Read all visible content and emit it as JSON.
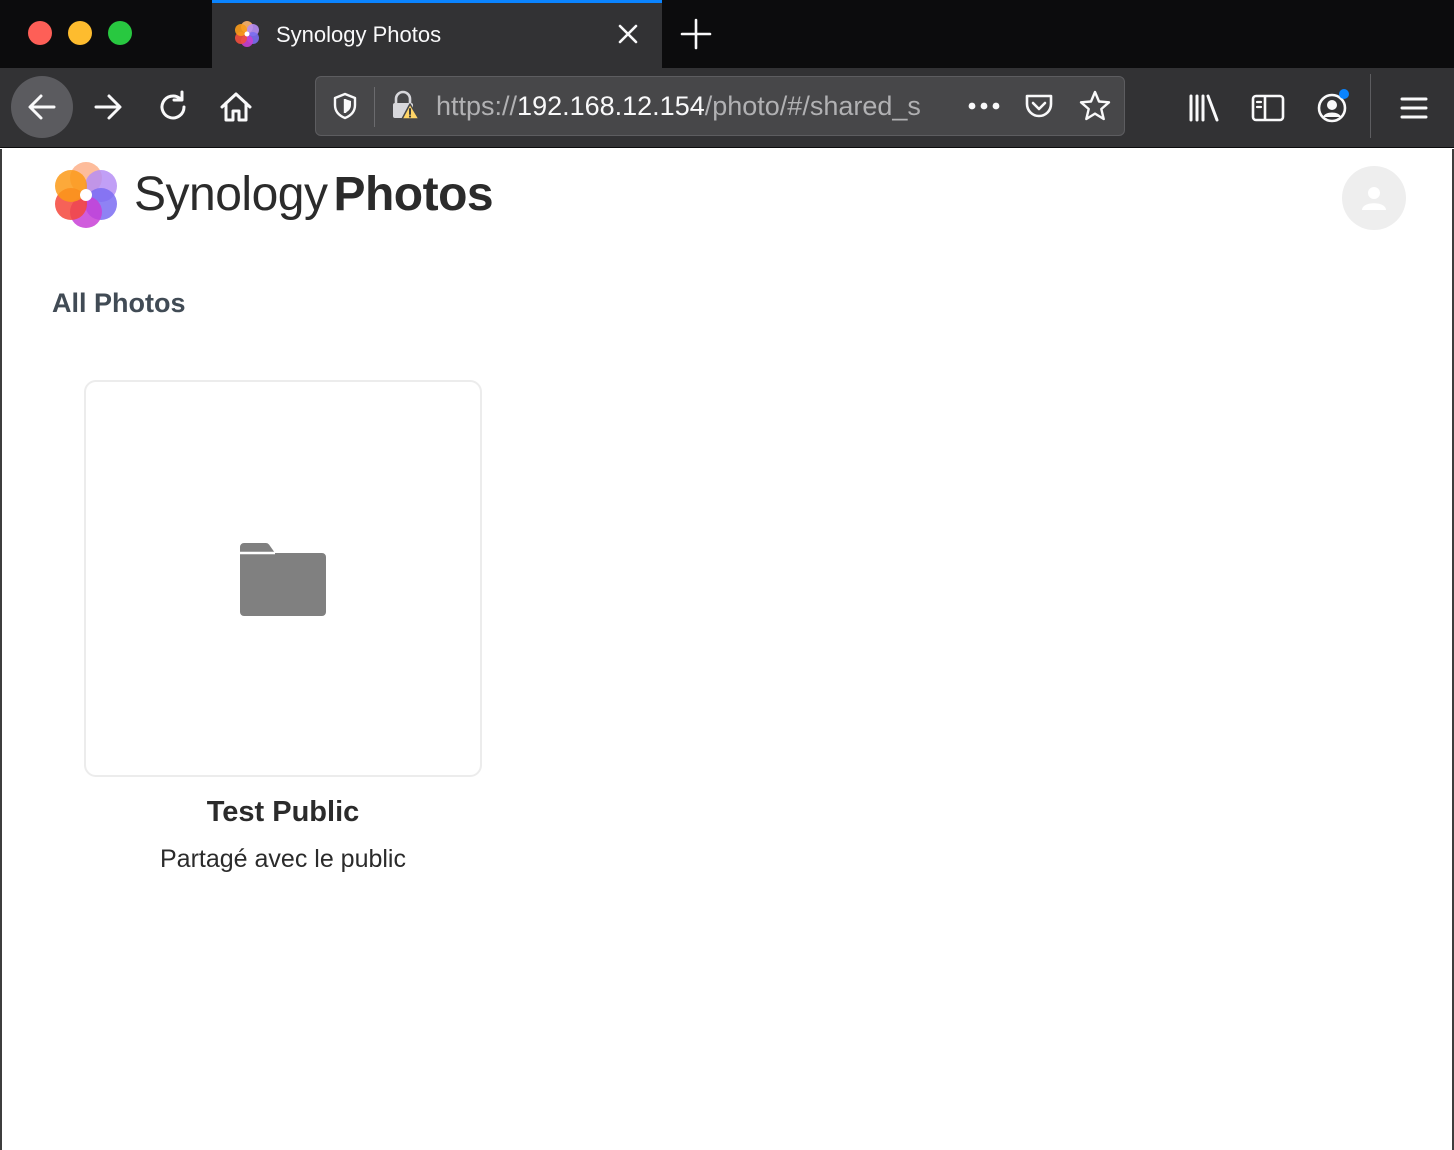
{
  "browser": {
    "tab": {
      "title": "Synology Photos"
    },
    "url": {
      "scheme": "https://",
      "host": "192.168.12.154",
      "path": "/photo/#/shared_s"
    }
  },
  "app": {
    "logo": {
      "light": "Synology",
      "bold": "Photos"
    },
    "section_title": "All Photos",
    "albums": [
      {
        "title": "Test Public",
        "subtitle": "Partagé avec le public",
        "icon": "folder-icon"
      }
    ]
  },
  "colors": {
    "chrome_dark": "#0c0c0d",
    "toolbar": "#323234",
    "tab_accent": "#0a84ff",
    "folder": "#808080",
    "section_title": "#414b55"
  }
}
